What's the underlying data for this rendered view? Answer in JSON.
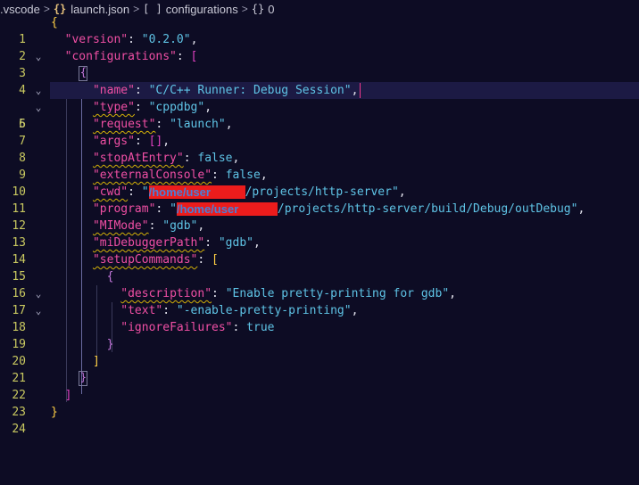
{
  "breadcrumb": {
    "folder": ".vscode",
    "file": "launch.json",
    "array": "configurations",
    "item": "0",
    "json_icon": "{}",
    "array_icon": "[ ]",
    "object_icon": "{}",
    "sep": ">"
  },
  "editor": {
    "line_numbers": [
      "1",
      "2",
      "3",
      "4",
      "5",
      "6",
      "7",
      "8",
      "9",
      "10",
      "11",
      "12",
      "13",
      "14",
      "15",
      "16",
      "17",
      "18",
      "19",
      "20",
      "21",
      "22",
      "23",
      "24"
    ],
    "fold_icon": "chevron-down-icon",
    "version_key": "\"version\"",
    "version_val": "\"0.2.0\"",
    "configurations_key": "\"configurations\"",
    "name_key": "\"name\"",
    "name_val": "\"C/C++ Runner: Debug Session\"",
    "type_key": "\"type\"",
    "type_val": "\"cppdbg\"",
    "request_key": "\"request\"",
    "request_val": "\"launch\"",
    "args_key": "\"args\"",
    "args_val": "[]",
    "stopAtEntry_key": "\"stopAtEntry\"",
    "stopAtEntry_val": "false",
    "externalConsole_key": "\"externalConsole\"",
    "externalConsole_val": "false",
    "cwd_key": "\"cwd\"",
    "cwd_redacted": "/home/user",
    "cwd_rest": "/projects/http-server\"",
    "program_key": "\"program\"",
    "program_redacted": "/home/user",
    "program_rest": "/projects/http-server/build/Debug/outDebug\"",
    "MIMode_key": "\"MIMode\"",
    "MIMode_val": "\"gdb\"",
    "miDebuggerPath_key": "\"miDebuggerPath\"",
    "miDebuggerPath_val": "\"gdb\"",
    "setupCommands_key": "\"setupCommands\"",
    "description_key": "\"description\"",
    "description_val": "\"Enable pretty-printing for gdb\"",
    "text_key": "\"text\"",
    "text_val": "\"-enable-pretty-printing\"",
    "ignoreFailures_key": "\"ignoreFailures\"",
    "ignoreFailures_val": "true"
  }
}
